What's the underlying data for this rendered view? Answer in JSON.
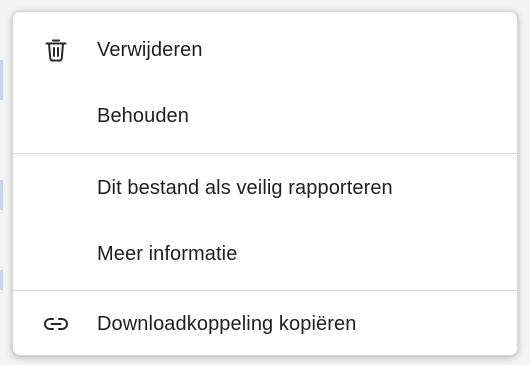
{
  "menu": {
    "items": [
      {
        "label": "Verwijderen",
        "icon": "trash-icon"
      },
      {
        "label": "Behouden",
        "icon": ""
      },
      {
        "label": "Dit bestand als veilig rapporteren",
        "icon": ""
      },
      {
        "label": "Meer informatie",
        "icon": ""
      },
      {
        "label": "Downloadkoppeling kopiëren",
        "icon": "link-icon"
      }
    ]
  },
  "colors": {
    "menu_background": "#ffffff",
    "text": "#1f1f1f",
    "divider": "#dcdcdc"
  }
}
